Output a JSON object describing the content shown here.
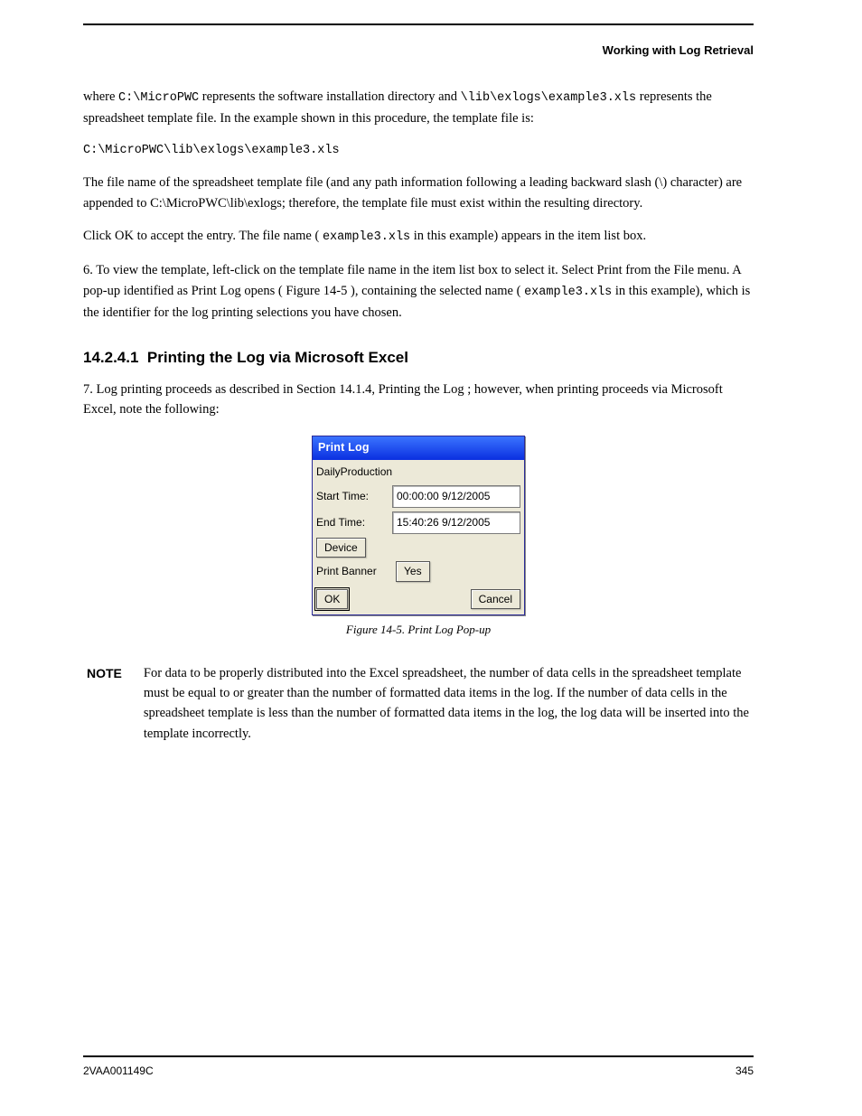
{
  "header": {
    "title": "Working with Log Retrieval"
  },
  "body": {
    "p1_pre": "where ",
    "p1_path1": "C:\\MicroPWC",
    "p1_mid": " represents the software installation directory and ",
    "p1_path2": "\\lib\\exlogs\\example3.xls",
    "p1_end": " represents the spreadsheet template file. In the example shown in this procedure, the template file is:",
    "p2_path": "C:\\MicroPWC\\lib\\exlogs\\example3.xls",
    "p3": "The file name of the spreadsheet template file (and any path information following a leading backward slash (\\) character) are appended to C:\\MicroPWC\\lib\\exlogs; therefore, the template file must exist within the resulting directory.",
    "p4_pre": "Click OK to accept the entry. The file name (",
    "p4_file": "example3.xls",
    "p4_end": " in this example) appears in the item list box.",
    "p5_pre": "6. To view the template, left-click on the template file name in the item list box to select it. Select Print from the File menu. A pop-up identified as Print Log opens (",
    "p5_figref": "Figure 14-5",
    "p5_mid": "), containing the selected name (",
    "p5_file": "example3.xls",
    "p5_end": " in this example), which is the identifier for the log printing selections you have chosen.",
    "p6_pre": "7. Log printing proceeds as described in ",
    "p6_ref": "Section 14.1.4, Printing the Log",
    "p6_end": "; however, when printing proceeds via Microsoft Excel, note the following:"
  },
  "heading": {
    "num": "14.2.4.1",
    "title": "Printing the Log via Microsoft Excel"
  },
  "dialog": {
    "title": "Print Log",
    "name": "DailyProduction",
    "start_label": "Start Time:",
    "start_value": "00:00:00  9/12/2005",
    "end_label": "End Time:",
    "end_value": "15:40:26  9/12/2005",
    "device_btn": "Device",
    "banner_label": "Print Banner",
    "banner_btn": "Yes",
    "ok": "OK",
    "cancel": "Cancel"
  },
  "figure": {
    "caption": "Figure 14-5. Print Log Pop-up"
  },
  "note": {
    "label": "NOTE",
    "text": "For data to be properly distributed into the Excel spreadsheet, the number of data cells in the spreadsheet template must be equal to or greater than the number of formatted data items in the log. If the number of data cells in the spreadsheet template is less than the number of formatted data items in the log, the log data will be inserted into the template incorrectly."
  },
  "footer": {
    "left": "2VAA001149C",
    "right_top": "345",
    "right_bottom": ""
  }
}
